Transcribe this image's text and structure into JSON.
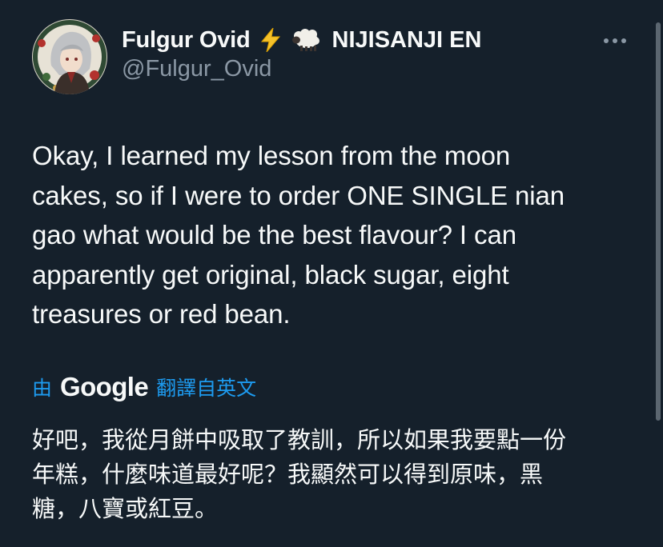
{
  "tweet": {
    "display_name": "Fulgur Ovid",
    "emoji_1": "lightning-icon",
    "emoji_2": "sheep-icon",
    "affiliation": "NIJISANJI EN",
    "handle": "@Fulgur_Ovid",
    "more_icon": "more-horizontal-icon",
    "text": "Okay, I learned my lesson from the moon\ncakes, so if I were to order ONE SINGLE nian\ngao what would be the best flavour? I can\napparently get original, black sugar, eight\ntreasures or red bean."
  },
  "translation": {
    "by_label": "由",
    "provider": "Google",
    "translated_from": "翻譯自英文",
    "text": "好吧，我從月餅中吸取了教訓，所以如果我要點一份\n年糕，什麼味道最好呢？我顯然可以得到原味，黑\n糖，八寶或紅豆。"
  },
  "colors": {
    "background": "#15202b",
    "text_primary": "#f7f9f9",
    "text_secondary": "#8b98a5",
    "link": "#1d9bf0"
  }
}
